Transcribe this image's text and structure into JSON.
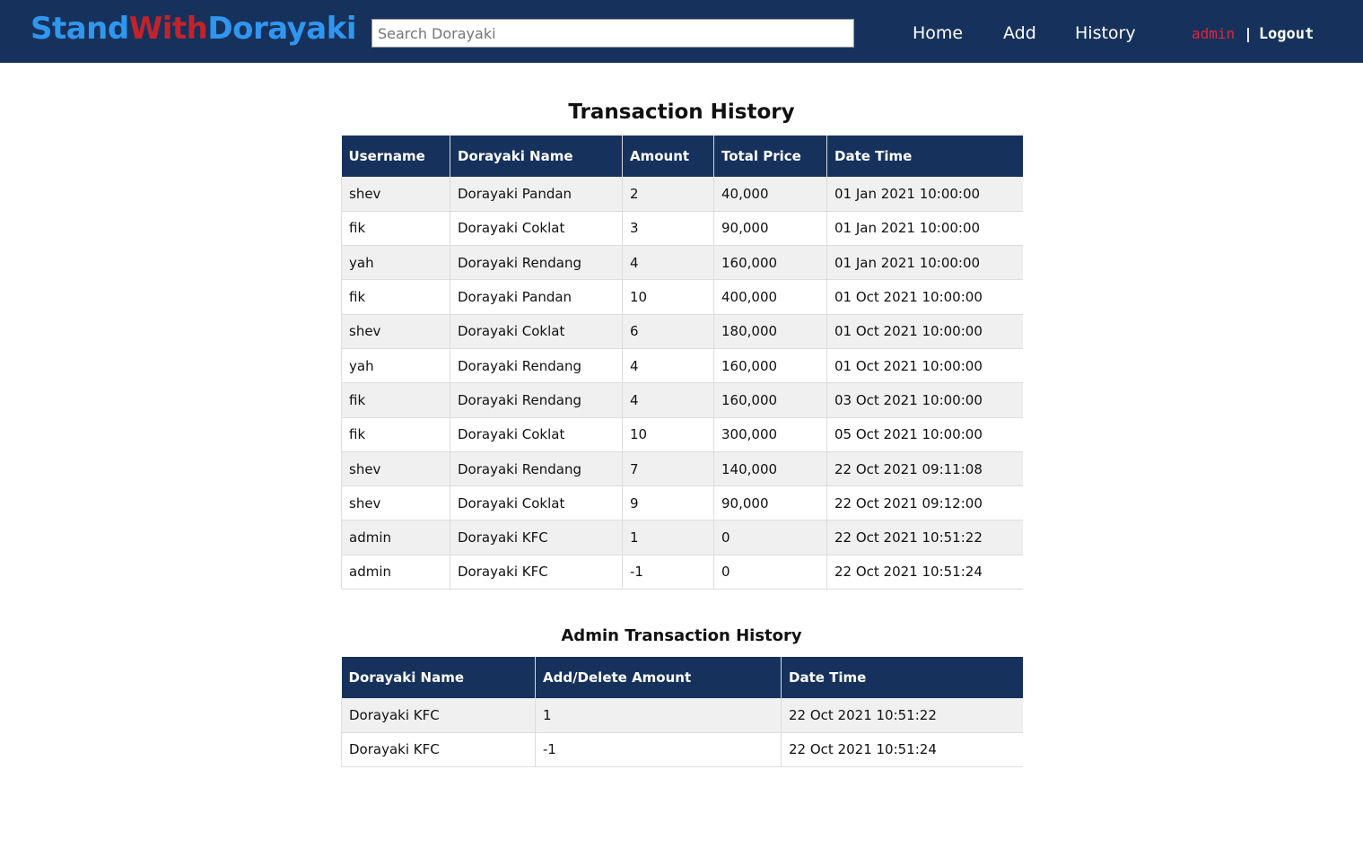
{
  "navbar": {
    "brand": {
      "part1": "Stand",
      "part2": "With",
      "part3": "Dorayaki"
    },
    "search_placeholder": "Search Dorayaki",
    "links": [
      "Home",
      "Add",
      "History"
    ],
    "user": "admin",
    "separator": "|",
    "logout": "Logout"
  },
  "main": {
    "title": "Transaction History",
    "headers": [
      "Username",
      "Dorayaki Name",
      "Amount",
      "Total Price",
      "Date Time"
    ],
    "rows": [
      [
        "shev",
        "Dorayaki Pandan",
        "2",
        "40,000",
        "01 Jan 2021 10:00:00"
      ],
      [
        "fik",
        "Dorayaki Coklat",
        "3",
        "90,000",
        "01 Jan 2021 10:00:00"
      ],
      [
        "yah",
        "Dorayaki Rendang",
        "4",
        "160,000",
        "01 Jan 2021 10:00:00"
      ],
      [
        "fik",
        "Dorayaki Pandan",
        "10",
        "400,000",
        "01 Oct 2021 10:00:00"
      ],
      [
        "shev",
        "Dorayaki Coklat",
        "6",
        "180,000",
        "01 Oct 2021 10:00:00"
      ],
      [
        "yah",
        "Dorayaki Rendang",
        "4",
        "160,000",
        "01 Oct 2021 10:00:00"
      ],
      [
        "fik",
        "Dorayaki Rendang",
        "4",
        "160,000",
        "03 Oct 2021 10:00:00"
      ],
      [
        "fik",
        "Dorayaki Coklat",
        "10",
        "300,000",
        "05 Oct 2021 10:00:00"
      ],
      [
        "shev",
        "Dorayaki Rendang",
        "7",
        "140,000",
        "22 Oct 2021 09:11:08"
      ],
      [
        "shev",
        "Dorayaki Coklat",
        "9",
        "90,000",
        "22 Oct 2021 09:12:00"
      ],
      [
        "admin",
        "Dorayaki KFC",
        "1",
        "0",
        "22 Oct 2021 10:51:22"
      ],
      [
        "admin",
        "Dorayaki KFC",
        "-1",
        "0",
        "22 Oct 2021 10:51:24"
      ]
    ]
  },
  "admin": {
    "title": "Admin Transaction History",
    "headers": [
      "Dorayaki Name",
      "Add/Delete Amount",
      "Date Time"
    ],
    "rows": [
      [
        "Dorayaki KFC",
        "1",
        "22 Oct 2021 10:51:22"
      ],
      [
        "Dorayaki KFC",
        "-1",
        "22 Oct 2021 10:51:24"
      ]
    ]
  },
  "colors": {
    "navbar_bg": "#16325c",
    "brand_blue": "#3096ef",
    "brand_red": "#c0232c",
    "user_red": "#e0253a",
    "row_stripe": "#f0f0f0"
  }
}
